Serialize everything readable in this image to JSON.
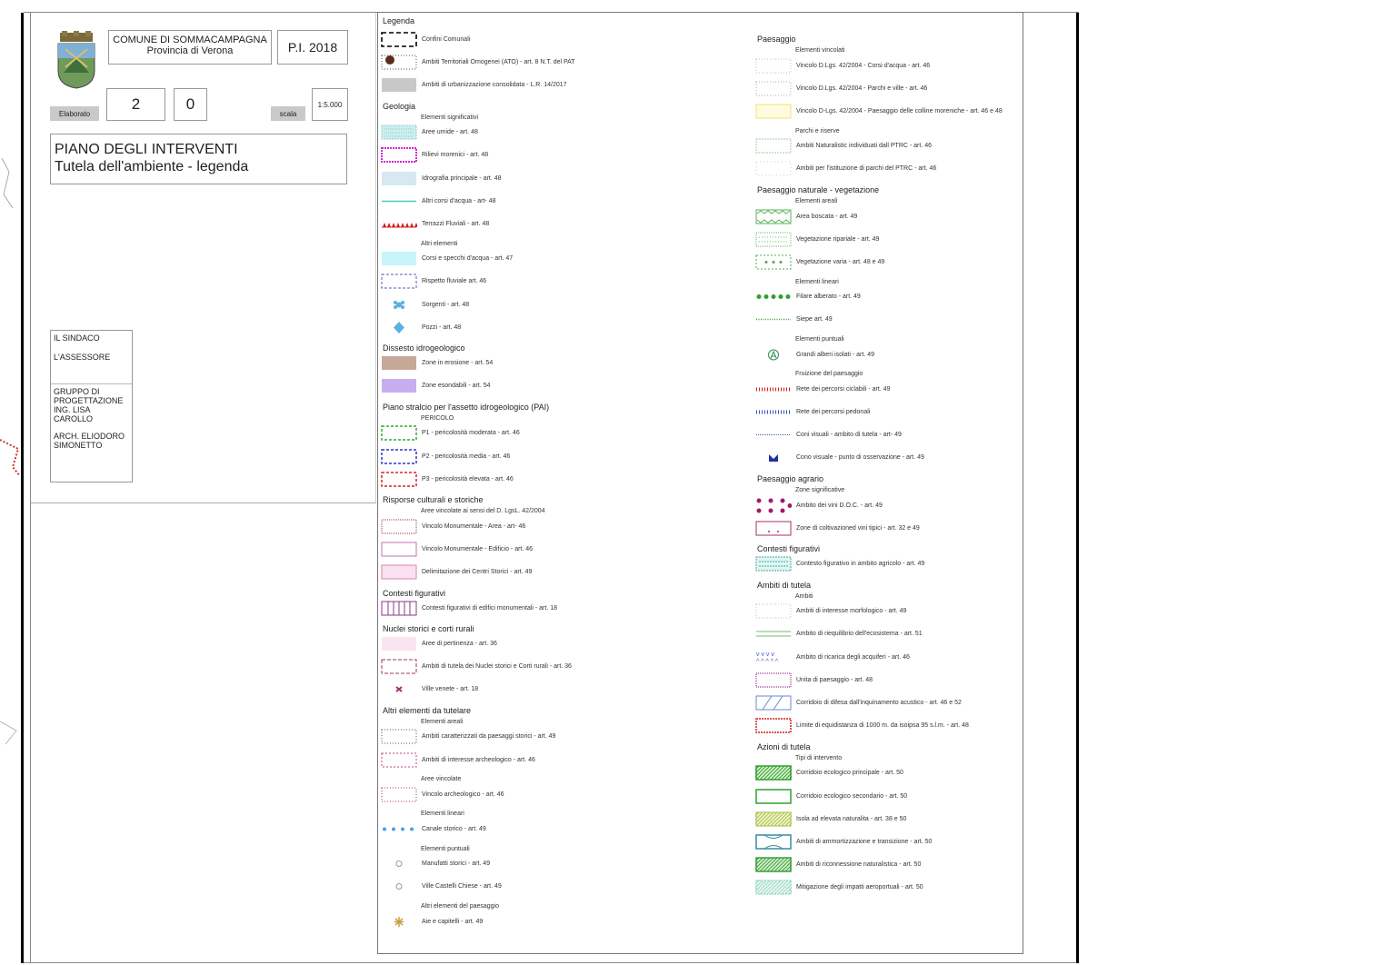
{
  "title_block": {
    "municipality": "COMUNE DI SOMMACAMPAGNA",
    "province": "Provincia di Verona",
    "plan_code": "P.I. 2018",
    "elaborato_label": "Elaborato",
    "elaborato_num1": "2",
    "elaborato_num2": "0",
    "scale_label": "scala",
    "scale_value": "1:5.000",
    "title_line1": "PIANO DEGLI INTERVENTI",
    "title_line2": "Tutela dell'ambiente - legenda",
    "signatures": {
      "sindaco": "IL SINDACO",
      "assessore": "L'ASSESSORE",
      "gruppo": "GRUPPO DI PROGETTAZIONE ING. LISA CAROLLO",
      "arch": "ARCH. ELIODORO SIMONETTO"
    }
  },
  "legend": {
    "title": "Legenda",
    "left": [
      {
        "kind": "item",
        "sym": "dash-black",
        "label": "Confini Comunali"
      },
      {
        "kind": "item",
        "sym": "ato",
        "label": "Ambiti Territoriali Omogenei (ATO) - art. 8 N.T. del PAT"
      },
      {
        "kind": "item",
        "sym": "grey",
        "label": "Ambiti di urbanizzazione consolidata - L.R. 14/2017"
      },
      {
        "kind": "head",
        "label": "Geologia"
      },
      {
        "kind": "sub",
        "label": "Elementi significativi"
      },
      {
        "kind": "item",
        "sym": "wetland",
        "label": "Aree umide - art. 48"
      },
      {
        "kind": "item",
        "sym": "moraine",
        "label": "Rilievi morenici - art. 48"
      },
      {
        "kind": "item",
        "sym": "lightblue",
        "label": "Idrografia principale - art. 48"
      },
      {
        "kind": "item",
        "sym": "waterline",
        "label": "Altri corsi d'acqua - art- 48"
      },
      {
        "kind": "item",
        "sym": "terrace",
        "label": "Terrazzi Fluviali - art. 48"
      },
      {
        "kind": "sub",
        "label": "Altri elementi"
      },
      {
        "kind": "item",
        "sym": "cyan",
        "label": "Corsi e specchi d'acqua - art. 47"
      },
      {
        "kind": "item",
        "sym": "dash-blue",
        "label": "Rispetto fluviale art. 46"
      },
      {
        "kind": "item",
        "sym": "spring",
        "label": "Sorgenti - art. 48"
      },
      {
        "kind": "item",
        "sym": "well",
        "label": "Pozzi - art. 48"
      },
      {
        "kind": "head",
        "label": "Dissesto idrogeologico"
      },
      {
        "kind": "item",
        "sym": "erosion",
        "label": "Zone in erosione - art. 54"
      },
      {
        "kind": "item",
        "sym": "flood",
        "label": "Zone esondabili - art. 54"
      },
      {
        "kind": "head",
        "label": "Piano stralcio per l'assetto idrogeologico (PAI)"
      },
      {
        "kind": "sub",
        "label": "PERICOLO"
      },
      {
        "kind": "item",
        "sym": "p1",
        "label": "P1 - pericolosità moderata - art. 46"
      },
      {
        "kind": "item",
        "sym": "p2",
        "label": "P2 - pericolosità media - art. 46"
      },
      {
        "kind": "item",
        "sym": "p3",
        "label": "P3 - pericolosità elevata - art. 46"
      },
      {
        "kind": "head",
        "label": "Risporse culturali e storiche"
      },
      {
        "kind": "sub",
        "label": "Aree vincolate ai sensi del D. LgsL. 42/2004"
      },
      {
        "kind": "item",
        "sym": "dot-magenta",
        "label": "Vincolo Monumentale - Area - art- 46"
      },
      {
        "kind": "item",
        "sym": "solid-magenta",
        "label": "Vincolo Monumentale - Edificio - art. 46"
      },
      {
        "kind": "item",
        "sym": "pink-fill",
        "label": "Delimitazione dei Centri Storici - art. 49"
      },
      {
        "kind": "head",
        "label": "Contesti figurativi"
      },
      {
        "kind": "item",
        "sym": "grid-purple",
        "label": "Contesti figurativi di edifici monumentali - art. 18"
      },
      {
        "kind": "head",
        "label": "Nuclei storici e corti rurali"
      },
      {
        "kind": "item",
        "sym": "pale-pink",
        "label": "Aree di pertinenza - art. 36"
      },
      {
        "kind": "item",
        "sym": "dash-magenta",
        "label": "Ambiti di tutela dei Nuclei storici e Corti rurali - art. 36"
      },
      {
        "kind": "item",
        "sym": "villa",
        "label": "Ville venete - art. 18"
      },
      {
        "kind": "head",
        "label": "Altri elementi da tutelare"
      },
      {
        "kind": "sub",
        "label": "Elementi areali"
      },
      {
        "kind": "item",
        "sym": "landscape",
        "label": "Ambiti caratterizzati da paesaggi storici - art. 49"
      },
      {
        "kind": "item",
        "sym": "archeo",
        "label": "Ambiti di interesse archeologico - art. 46"
      },
      {
        "kind": "sub",
        "label": "Aree vincolate"
      },
      {
        "kind": "item",
        "sym": "archeo2",
        "label": "Vincolo archeologico - art. 46"
      },
      {
        "kind": "sub",
        "label": "Elementi lineari"
      },
      {
        "kind": "item",
        "sym": "canal",
        "label": "Canale storico - art. 49"
      },
      {
        "kind": "sub",
        "label": "Elementi puntuali"
      },
      {
        "kind": "item",
        "sym": "manufatto",
        "label": "Manufatti storici - art. 49"
      },
      {
        "kind": "item",
        "sym": "manufatto",
        "label": "Ville Castelli Chiese - art. 49"
      },
      {
        "kind": "sub",
        "label": "Altri elementi del paesaggio"
      },
      {
        "kind": "item",
        "sym": "capitello",
        "label": "Aie e capitelli - art. 49"
      }
    ],
    "right": [
      {
        "kind": "head",
        "label": "Paesaggio"
      },
      {
        "kind": "sub",
        "label": "Elementi vincolati"
      },
      {
        "kind": "item",
        "sym": "v-green1",
        "label": "Vincolo D.Lgs. 42/2004 - Corsi d'acqua - art. 46"
      },
      {
        "kind": "item",
        "sym": "v-green2",
        "label": "Vincolo D.Lgs. 42/2004 - Parchi e ville - art. 46"
      },
      {
        "kind": "item",
        "sym": "v-yellow",
        "label": "Vincolo D-Lgs. 42/2004 - Paesaggio delle colline moreniche - art. 46 e 48"
      },
      {
        "kind": "sub",
        "label": "Parchi e riserve"
      },
      {
        "kind": "item",
        "sym": "v-green3",
        "label": "Ambiti Naturalistic individuati dall PTRC - art. 46"
      },
      {
        "kind": "item",
        "sym": "v-green4",
        "label": "Ambiti per l'istituzione di parchi del PTRC - art. 46"
      },
      {
        "kind": "head",
        "label": "Paesaggio naturale - vegetazione"
      },
      {
        "kind": "sub",
        "label": "Elementi areali"
      },
      {
        "kind": "item",
        "sym": "wood",
        "label": "Area boscata - art. 49"
      },
      {
        "kind": "item",
        "sym": "riparian",
        "label": "Vegetazione ripariale - art. 49"
      },
      {
        "kind": "item",
        "sym": "veg-varia",
        "label": "Vegetazione varia - art. 48 e 49"
      },
      {
        "kind": "sub",
        "label": "Elementi lineari"
      },
      {
        "kind": "item",
        "sym": "filare",
        "label": "Filare alberato - art. 49"
      },
      {
        "kind": "item",
        "sym": "siepe",
        "label": "Siepe art. 49"
      },
      {
        "kind": "sub",
        "label": "Elementi puntuali"
      },
      {
        "kind": "item",
        "sym": "tree",
        "label": "Grandi alberi isolati - art. 49"
      },
      {
        "kind": "sub",
        "label": "Fruizione del paesaggio"
      },
      {
        "kind": "item",
        "sym": "cycle",
        "label": "Rete dei percorsi ciclabili - art. 49"
      },
      {
        "kind": "item",
        "sym": "walk",
        "label": "Rete dei percorsi pedonali"
      },
      {
        "kind": "item",
        "sym": "view",
        "label": "Coni visuali - ambito di tutela - art- 49"
      },
      {
        "kind": "item",
        "sym": "viewpoint",
        "label": "Cono visuale - punto di osservazione - art. 49"
      },
      {
        "kind": "head",
        "label": "Paesaggio agrario"
      },
      {
        "kind": "sub",
        "label": "Zone significative"
      },
      {
        "kind": "item",
        "sym": "doc",
        "label": "Ambito dei vini D.O.C. - art. 49"
      },
      {
        "kind": "item",
        "sym": "wine-zone",
        "label": "Zone di coltivazioned vini tipici - art. 32 e 49"
      },
      {
        "kind": "head",
        "label": "Contesti figurativi"
      },
      {
        "kind": "item",
        "sym": "agri-ctx",
        "label": "Contesto figurativo in ambito agricolo - art. 49"
      },
      {
        "kind": "head",
        "label": "Ambiti di tutela"
      },
      {
        "kind": "sub",
        "label": "Ambiti"
      },
      {
        "kind": "item",
        "sym": "morph",
        "label": "Ambiti di interesse morfologico - art. 49"
      },
      {
        "kind": "item",
        "sym": "eco-bal",
        "label": "Ambito di riequilibrio dell'ecosistema - art. 51"
      },
      {
        "kind": "item",
        "sym": "recharge",
        "label": "Ambito di ricarica degli acquiferi - art. 46"
      },
      {
        "kind": "item",
        "sym": "unit",
        "label": "Unita di paesaggio - art. 48"
      },
      {
        "kind": "item",
        "sym": "noise",
        "label": "Corridoio di difesa dall'inquinamento acustico - art. 46 e 52"
      },
      {
        "kind": "item",
        "sym": "equid",
        "label": "Limite di equidistanza di 1000 m. da isoipsa 95 s.l.m. - art. 48"
      },
      {
        "kind": "head",
        "label": "Azioni di tutela"
      },
      {
        "kind": "sub",
        "label": "Tipi di intervento"
      },
      {
        "kind": "item",
        "sym": "corr-main",
        "label": "Corridoio ecologico principale - art. 50"
      },
      {
        "kind": "item",
        "sym": "corr-sec",
        "label": "Corridoio ecologico secondario - art. 50"
      },
      {
        "kind": "item",
        "sym": "isola",
        "label": "Isola ad elevata naturalita - art. 38 e 50"
      },
      {
        "kind": "item",
        "sym": "buffer",
        "label": "Ambiti di ammortizzazione e transizione - art. 50"
      },
      {
        "kind": "item",
        "sym": "reconn",
        "label": "Ambiti di riconnessione naturalistica - art. 50"
      },
      {
        "kind": "item",
        "sym": "airport",
        "label": "Mitigazione degli impatti aeroportuali - art. 50"
      }
    ]
  }
}
